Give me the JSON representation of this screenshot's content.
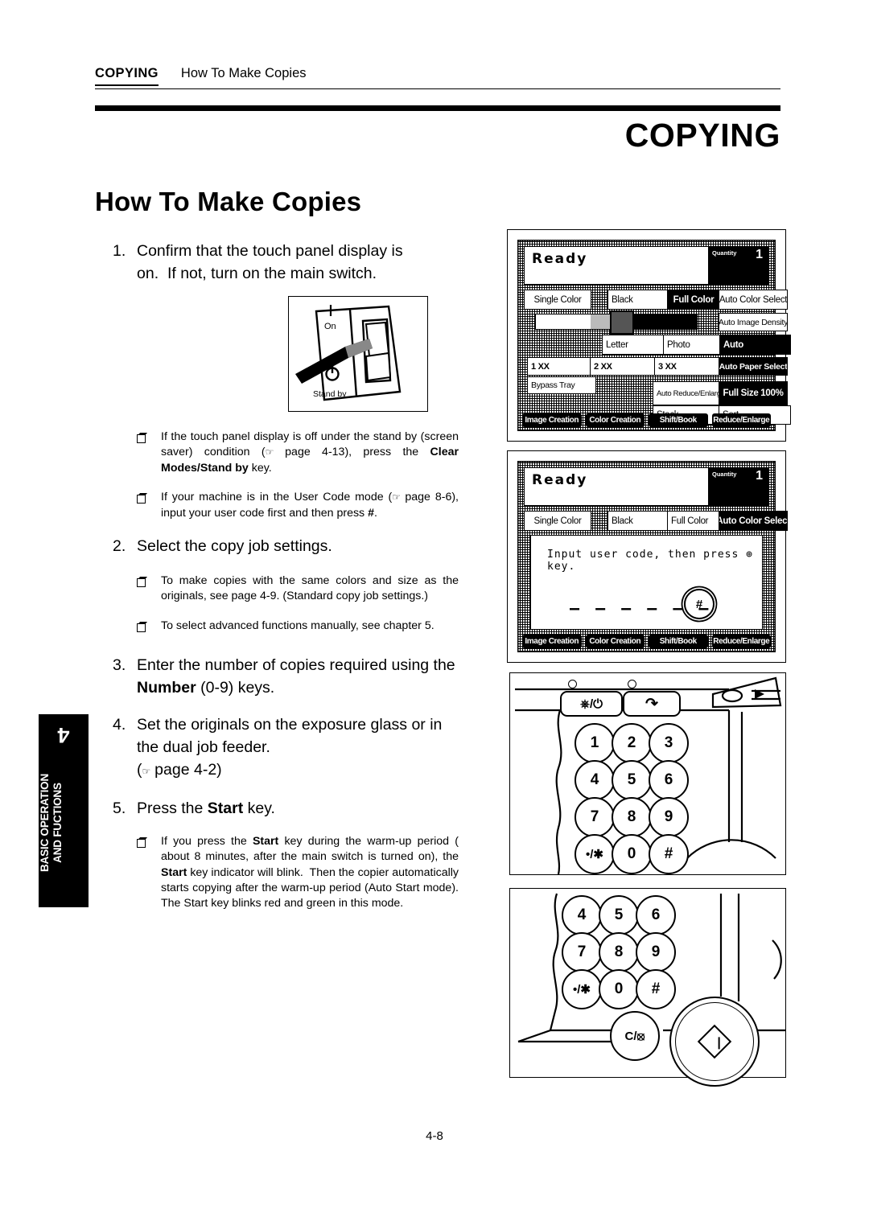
{
  "running_head": {
    "chapter": "COPYING",
    "title": "How To Make Copies"
  },
  "chapter_title": "COPYING",
  "section_title": "How To Make Copies",
  "page_number": "4-8",
  "side_tab": {
    "number": "4",
    "label_line1": "BASIC OPERATION",
    "label_line2": "AND FUCTIONS"
  },
  "steps": [
    {
      "num": "1.",
      "text": "Confirm that the touch panel display is on.  If not, turn on the main switch."
    },
    {
      "num": "2.",
      "text": "Select the copy job settings."
    },
    {
      "num": "3.",
      "text": "Enter the number of copies required using the Number (0-9) keys."
    },
    {
      "num": "4.",
      "text": "Set the originals on the exposure glass or in the dual job feeder. ( page 4-2)"
    },
    {
      "num": "5.",
      "text": "Press the Start key."
    }
  ],
  "bullets": {
    "b1": "If the touch panel display is off under the stand by (screen saver) condition ( page 4-13), press the Clear Modes/Stand by key.",
    "b2": "If your machine is in the User Code mode ( page 8-6), input your user code first and then press #.",
    "b3": "To make copies with the same colors and size as the originals, see page 4-9. (Standard copy job settings.)",
    "b4": "To select advanced functions manually, see chapter 5.",
    "b5": "If you press the Start key during the warm-up period ( about 8 minutes, after the main switch is turned on), the Start key indicator will blink.  Then the copier automatically starts copying after the warm-up period (Auto Start mode). The Start key blinks red and green in this mode."
  },
  "switch_figure": {
    "on_label": "On",
    "standby_label": "Stand by"
  },
  "panel1": {
    "status": "Ready",
    "quantity_label": "Quantity",
    "quantity_value": "1",
    "color_row": [
      "Single Color",
      "Black",
      "Full Color",
      "Auto Color Select"
    ],
    "color_selected": "Full Color",
    "density_button": "Auto Image Density",
    "paper_row": [
      "Letter",
      "Photo",
      "Auto"
    ],
    "paper_selected": "Auto",
    "tray_row": [
      "1 XX",
      "2 XX",
      "3 XX",
      "Auto Paper Select"
    ],
    "bypass": "Bypass Tray",
    "reduce_auto": "Auto Reduce/Enlarge",
    "full_size": "Full Size 100%",
    "stack": "Stack",
    "sort": "Sort",
    "tabs": [
      "Image Creation",
      "Color Creation",
      "Shift/Book",
      "Reduce/Enlarge"
    ]
  },
  "panel2": {
    "status": "Ready",
    "quantity_label": "Quantity",
    "quantity_value": "1",
    "color_row": [
      "Single Color",
      "Black",
      "Full Color",
      "Auto Color Select"
    ],
    "color_selected": "Auto Color Select",
    "prompt": "Input user code, then press ⊕ key.",
    "code_dashes": "— — — — — —",
    "hash_key": "#",
    "tabs": [
      "Image Creation",
      "Color Creation",
      "Shift/Book",
      "Reduce/Enlarge"
    ]
  },
  "keypad_figure": {
    "keys": [
      "1",
      "2",
      "3",
      "4",
      "5",
      "6",
      "7",
      "8",
      "9",
      "•/✱",
      "0",
      "#"
    ],
    "clear_modes_key": "⎈/⏻",
    "interrupt_key": "↷"
  },
  "start_figure": {
    "keys": [
      "4",
      "5",
      "6",
      "7",
      "8",
      "9",
      "•/✱",
      "0",
      "#"
    ],
    "clear_stop_key": "C/⦻",
    "start_key": "start-diamond"
  }
}
